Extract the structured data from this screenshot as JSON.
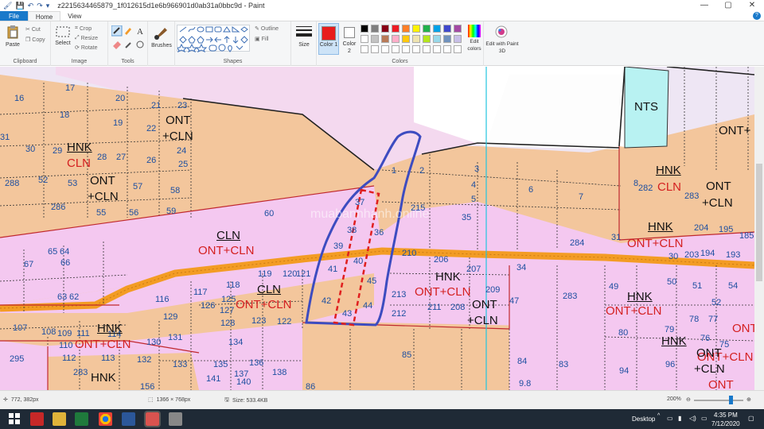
{
  "window": {
    "title": "z2215634465879_1f012615d1e6b966901d0ab31a0bbc9d - Paint",
    "controls": {
      "minimize": "—",
      "maximize": "▢",
      "close": "✕"
    }
  },
  "quick_access": {
    "save_icon": "save-icon",
    "undo_icon": "undo-icon",
    "redo_icon": "redo-icon",
    "menu_glyph": "▾"
  },
  "tabs": [
    "File",
    "Home",
    "View"
  ],
  "help_glyph": "?",
  "ribbon": {
    "clipboard": {
      "paste": "Paste",
      "cut": "Cut",
      "copy": "Copy",
      "label": "Clipboard"
    },
    "image": {
      "select": "Select",
      "crop": "Crop",
      "resize": "Resize",
      "rotate": "Rotate",
      "label": "Image"
    },
    "tools": {
      "label": "Tools"
    },
    "brushes": {
      "label": "Brushes"
    },
    "shapes": {
      "outline": "Outline",
      "fill": "Fill",
      "label": "Shapes"
    },
    "size": {
      "label": "Size"
    },
    "colors": {
      "color1": "Color 1",
      "color2": "Color 2",
      "edit_colors": "Edit colors",
      "label": "Colors",
      "color1_value": "#e81c1c",
      "color2_value": "#ffffff",
      "palette_row1": [
        "#000000",
        "#7f7f7f",
        "#880015",
        "#ed1c24",
        "#ff7f27",
        "#fff200",
        "#22b14c",
        "#00a2e8",
        "#3f48cc",
        "#a349a4"
      ],
      "palette_row2": [
        "#ffffff",
        "#c3c3c3",
        "#b97a57",
        "#ffaec9",
        "#ffc90e",
        "#efe4b0",
        "#b5e61d",
        "#99d9ea",
        "#7092be",
        "#c8bfe7"
      ]
    },
    "paint3d": {
      "label": "Edit with Paint 3D"
    }
  },
  "map": {
    "watermark": "muabannhanh.online",
    "numbers": [
      {
        "t": "17"
      },
      {
        "t": "16"
      },
      {
        "t": "20"
      },
      {
        "t": "21"
      },
      {
        "t": "23"
      },
      {
        "t": "18"
      },
      {
        "t": "19"
      },
      {
        "t": "22"
      },
      {
        "t": "31"
      },
      {
        "t": "30"
      },
      {
        "t": "29"
      },
      {
        "t": "28"
      },
      {
        "t": "27"
      },
      {
        "t": "26"
      },
      {
        "t": "24"
      },
      {
        "t": "25"
      },
      {
        "t": "288"
      },
      {
        "t": "52"
      },
      {
        "t": "53"
      },
      {
        "t": "57"
      },
      {
        "t": "58"
      },
      {
        "t": "286"
      },
      {
        "t": "55"
      },
      {
        "t": "56"
      },
      {
        "t": "59"
      },
      {
        "t": "60"
      },
      {
        "t": "67"
      },
      {
        "t": "65"
      },
      {
        "t": "64"
      },
      {
        "t": "66"
      },
      {
        "t": "63"
      },
      {
        "t": "62"
      },
      {
        "t": "107"
      },
      {
        "t": "108"
      },
      {
        "t": "109"
      },
      {
        "t": "111"
      },
      {
        "t": "110"
      },
      {
        "t": "112"
      },
      {
        "t": "113"
      },
      {
        "t": "114"
      },
      {
        "t": "130"
      },
      {
        "t": "131"
      },
      {
        "t": "116"
      },
      {
        "t": "117"
      },
      {
        "t": "118"
      },
      {
        "t": "119"
      },
      {
        "t": "120"
      },
      {
        "t": "121"
      },
      {
        "t": "126"
      },
      {
        "t": "125"
      },
      {
        "t": "127"
      },
      {
        "t": "128"
      },
      {
        "t": "129"
      },
      {
        "t": "123"
      },
      {
        "t": "122"
      },
      {
        "t": "134"
      },
      {
        "t": "132"
      },
      {
        "t": "133"
      },
      {
        "t": "135"
      },
      {
        "t": "136"
      },
      {
        "t": "137"
      },
      {
        "t": "138"
      },
      {
        "t": "140"
      },
      {
        "t": "141"
      },
      {
        "t": "156"
      },
      {
        "t": "295"
      },
      {
        "t": "283"
      },
      {
        "t": "1"
      },
      {
        "t": "2"
      },
      {
        "t": "3"
      },
      {
        "t": "4"
      },
      {
        "t": "5"
      },
      {
        "t": "6"
      },
      {
        "t": "7"
      },
      {
        "t": "8"
      },
      {
        "t": "37"
      },
      {
        "t": "38"
      },
      {
        "t": "39"
      },
      {
        "t": "36"
      },
      {
        "t": "215"
      },
      {
        "t": "35"
      },
      {
        "t": "40"
      },
      {
        "t": "41"
      },
      {
        "t": "45"
      },
      {
        "t": "42"
      },
      {
        "t": "44"
      },
      {
        "t": "43"
      },
      {
        "t": "210"
      },
      {
        "t": "206"
      },
      {
        "t": "207"
      },
      {
        "t": "213"
      },
      {
        "t": "212"
      },
      {
        "t": "211"
      },
      {
        "t": "208"
      },
      {
        "t": "209"
      },
      {
        "t": "47"
      },
      {
        "t": "34"
      },
      {
        "t": "284"
      },
      {
        "t": "283"
      },
      {
        "t": "85"
      },
      {
        "t": "84"
      },
      {
        "t": "83"
      },
      {
        "t": "31"
      },
      {
        "t": "282"
      },
      {
        "t": "283"
      },
      {
        "t": "204"
      },
      {
        "t": "195"
      },
      {
        "t": "185"
      },
      {
        "t": "30"
      },
      {
        "t": "203"
      },
      {
        "t": "194"
      },
      {
        "t": "193"
      },
      {
        "t": "49"
      },
      {
        "t": "50"
      },
      {
        "t": "51"
      },
      {
        "t": "54"
      },
      {
        "t": "80"
      },
      {
        "t": "79"
      },
      {
        "t": "78"
      },
      {
        "t": "77"
      },
      {
        "t": "52"
      },
      {
        "t": "76"
      },
      {
        "t": "75"
      },
      {
        "t": "94"
      },
      {
        "t": "96"
      },
      {
        "t": "86"
      },
      {
        "t": "9.8"
      }
    ],
    "codes": [
      {
        "t": "ONT",
        "c": "k"
      },
      {
        "t": "+CLN",
        "c": "k"
      },
      {
        "t": "HNK",
        "c": "k",
        "u": true
      },
      {
        "t": "CLN",
        "c": "r"
      },
      {
        "t": "ONT",
        "c": "k"
      },
      {
        "t": "+CLN",
        "c": "k"
      },
      {
        "t": "CLN",
        "c": "k",
        "u": true
      },
      {
        "t": "ONT+CLN",
        "c": "r"
      },
      {
        "t": "CLN",
        "c": "k",
        "u": true
      },
      {
        "t": "ONT+CLN",
        "c": "r"
      },
      {
        "t": "HNK",
        "c": "k",
        "u": true
      },
      {
        "t": "ONT+CLN",
        "c": "r"
      },
      {
        "t": "HNK",
        "c": "k"
      },
      {
        "t": "ONT+CLN",
        "c": "r"
      },
      {
        "t": "HNK",
        "c": "k",
        "u": true
      },
      {
        "t": "ONT+CLN",
        "c": "r"
      },
      {
        "t": "ONT",
        "c": "k"
      },
      {
        "t": "+CLN",
        "c": "k"
      },
      {
        "t": "NTS",
        "c": "k"
      },
      {
        "t": "ONT+",
        "c": "k"
      },
      {
        "t": "HNK",
        "c": "k",
        "u": true
      },
      {
        "t": "CLN",
        "c": "r"
      },
      {
        "t": "ONT",
        "c": "k"
      },
      {
        "t": "+CLN",
        "c": "k"
      },
      {
        "t": "HNK",
        "c": "k",
        "u": true
      },
      {
        "t": "ONT+CLN",
        "c": "r"
      },
      {
        "t": "HNK",
        "c": "k",
        "u": true
      },
      {
        "t": "ONT+CLN",
        "c": "r"
      },
      {
        "t": "ONT",
        "c": "k"
      },
      {
        "t": "+CLN",
        "c": "k"
      },
      {
        "t": "ONT",
        "c": "r"
      },
      {
        "t": "ONT",
        "c": "r"
      },
      {
        "t": "HNK",
        "c": "k"
      }
    ]
  },
  "status": {
    "cursor": "772, 382px",
    "image_size": "1366 × 768px",
    "file_size": "Size: 533.4KB",
    "zoom": "200%",
    "zoom_out": "⊖",
    "zoom_in": "⊕"
  },
  "taskbar": {
    "desktop_label": "Desktop",
    "time": "4:35 PM",
    "date": "7/12/2020",
    "tray_glyph": "^"
  }
}
